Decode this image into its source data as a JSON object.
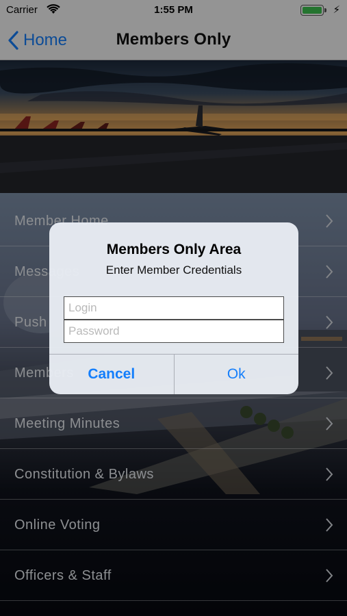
{
  "status_bar": {
    "carrier": "Carrier",
    "time": "1:55 PM",
    "charge_symbol": "⚡"
  },
  "nav": {
    "back_label": "Home",
    "title": "Members Only"
  },
  "menu": {
    "items": [
      {
        "label": "Member Home"
      },
      {
        "label": "Messages"
      },
      {
        "label": "Push"
      },
      {
        "label": "Members"
      },
      {
        "label": "Meeting Minutes"
      },
      {
        "label": "Constitution & Bylaws"
      },
      {
        "label": "Online Voting"
      },
      {
        "label": "Officers & Staff"
      }
    ]
  },
  "alert": {
    "title": "Members Only Area",
    "message": "Enter Member Credentials",
    "login_placeholder": "Login",
    "password_placeholder": "Password",
    "login_value": "",
    "password_value": "",
    "cancel_label": "Cancel",
    "ok_label": "Ok"
  },
  "colors": {
    "accent": "#147efb",
    "battery": "#3cc24f"
  }
}
